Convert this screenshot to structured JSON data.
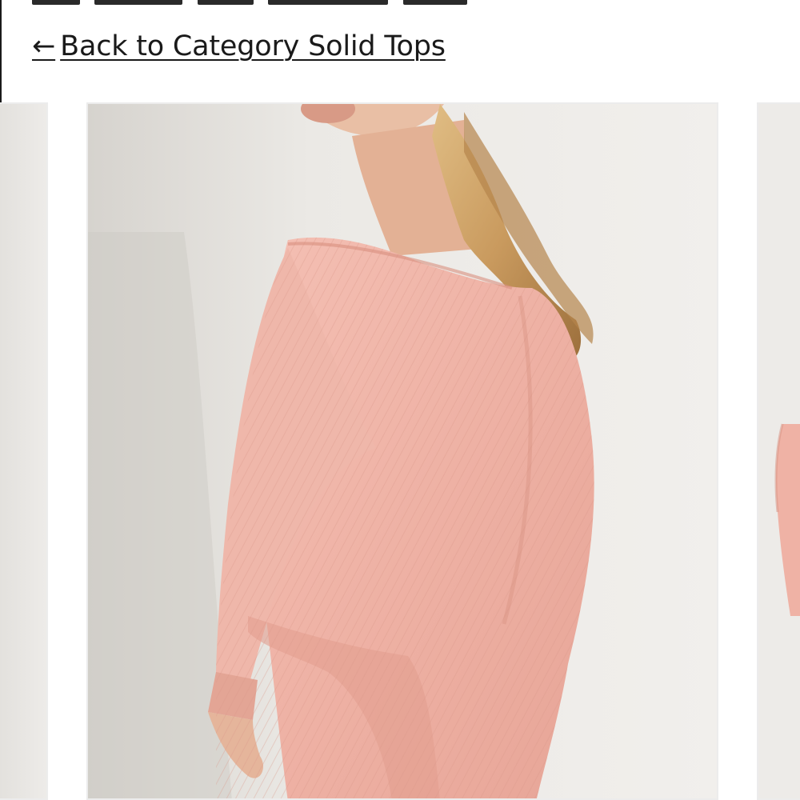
{
  "navigation": {
    "back_arrow": "←",
    "back_label": "Back to Category Solid Tops"
  },
  "product_images": {
    "count_visible": 3,
    "current_alt": "Model wearing pink ribbed dolman-sleeve top",
    "icons": [
      "product-photo"
    ],
    "colors": {
      "background": "#eceae7",
      "garment": "#f0b3a8",
      "hair": "#c99a5e"
    }
  }
}
